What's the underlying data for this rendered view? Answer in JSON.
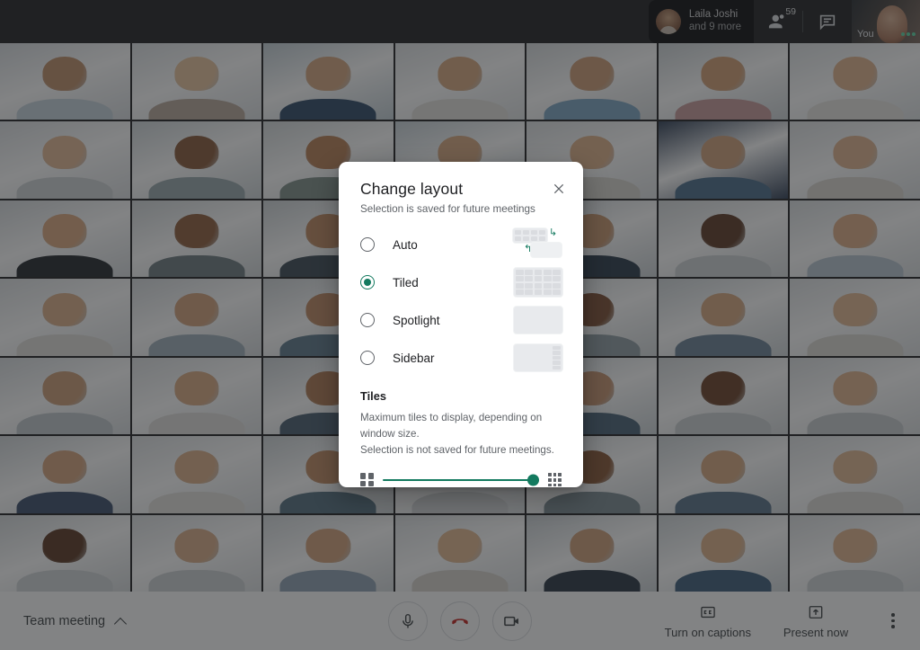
{
  "topbar": {
    "presence": {
      "name": "Laila Joshi",
      "more": "and 9 more"
    },
    "participants_icon": "people-icon",
    "participants_count": "59",
    "chat_icon": "chat-bubble-icon",
    "selfview_label": "You"
  },
  "grid": {
    "columns": 7,
    "rows": 7,
    "tiles": [
      {
        "skin": "#c08f6a",
        "hair": "#2a1a14",
        "top": "#c7d4dc",
        "bg": "#d9dde1"
      },
      {
        "skin": "#e8c49e",
        "hair": "#d8cdb6",
        "top": "#b9a89c",
        "bg": "#dde1e4"
      },
      {
        "skin": "#d6a77f",
        "hair": "#3a2a1e",
        "top": "#2f4a68",
        "bg": "#c3cfd6"
      },
      {
        "skin": "#d8a87f",
        "hair": "#6b4a32",
        "top": "#e4e2dc",
        "bg": "#dfe2e4"
      },
      {
        "skin": "#cf9e77",
        "hair": "#241812",
        "top": "#7ea6c4",
        "bg": "#d7dbdd"
      },
      {
        "skin": "#d4a075",
        "hair": "#2b1c14",
        "top": "#c99b9b",
        "bg": "#cdd3d6"
      },
      {
        "skin": "#e2b48e",
        "hair": "#8a6b45",
        "top": "#e8e6e2",
        "bg": "#dfe3e5"
      },
      {
        "skin": "#e3b894",
        "hair": "#8d6a44",
        "top": "#cfd3d6",
        "bg": "#dde0e3"
      },
      {
        "skin": "#8a5a3a",
        "hair": "#1b1210",
        "top": "#9aa9ad",
        "bg": "#cfd6d9"
      },
      {
        "skin": "#b97f56",
        "hair": "#221611",
        "top": "#7f8f8a",
        "bg": "#d4d9da"
      },
      {
        "skin": "#d8a87f",
        "hair": "#3c2a1d",
        "top": "#3f5a78",
        "bg": "#c8d2d8"
      },
      {
        "skin": "#e0b18a",
        "hair": "#6b4b2f",
        "top": "#d9d5cf",
        "bg": "#dde0e2"
      },
      {
        "skin": "#d2a27c",
        "hair": "#2a1c14",
        "top": "#4b6e8c",
        "bg": "#2f3e55"
      },
      {
        "skin": "#e2b58f",
        "hair": "#a07a4a",
        "top": "#dcd8d2",
        "bg": "#dee1e3"
      },
      {
        "skin": "#dca97f",
        "hair": "#5a3b23",
        "top": "#22272c",
        "bg": "#d7dbde"
      },
      {
        "skin": "#8f5e3c",
        "hair": "#1d1410",
        "top": "#6e7c80",
        "bg": "#d2d7d9"
      },
      {
        "skin": "#c08a60",
        "hair": "#231711",
        "top": "#3b4a55",
        "bg": "#cdd3d6"
      },
      {
        "skin": "#e0b68f",
        "hair": "#8b6840",
        "top": "#cfd2d4",
        "bg": "#dde0e2"
      },
      {
        "skin": "#c9966e",
        "hair": "#241812",
        "top": "#2b3a4a",
        "bg": "#cbd1d5"
      },
      {
        "skin": "#5d3a26",
        "hair": "#140e0b",
        "top": "#cfd3d5",
        "bg": "#d6dadc"
      },
      {
        "skin": "#dfae86",
        "hair": "#6a4a2d",
        "top": "#b8c6d2",
        "bg": "#dce0e2"
      },
      {
        "skin": "#dcb08a",
        "hair": "#2b1d14",
        "top": "#e1dfdb",
        "bg": "#dfe2e4"
      },
      {
        "skin": "#d4a37c",
        "hair": "#382619",
        "top": "#9fb0bb",
        "bg": "#d6dadd"
      },
      {
        "skin": "#c08a62",
        "hair": "#201611",
        "top": "#5f7a8c",
        "bg": "#cfd4d7"
      },
      {
        "skin": "#e1b58e",
        "hair": "#7b5a38",
        "top": "#d2d6d8",
        "bg": "#dde1e3"
      },
      {
        "skin": "#7d4f32",
        "hair": "#181110",
        "top": "#8f9ea4",
        "bg": "#d3d8da"
      },
      {
        "skin": "#d9a87f",
        "hair": "#3a2718",
        "top": "#6b8296",
        "bg": "#d0d6d9"
      },
      {
        "skin": "#e3b993",
        "hair": "#a8834f",
        "top": "#dedad4",
        "bg": "#e0e3e5"
      },
      {
        "skin": "#cd9d76",
        "hair": "#4a3120",
        "top": "#c2c9ce",
        "bg": "#d9dde0"
      },
      {
        "skin": "#dbaa82",
        "hair": "#2e2015",
        "top": "#e2e0dc",
        "bg": "#dee1e3"
      },
      {
        "skin": "#b07a52",
        "hair": "#1e1511",
        "top": "#4a5f70",
        "bg": "#ccd2d6"
      },
      {
        "skin": "#e0b289",
        "hair": "#6e5032",
        "top": "#d6d9db",
        "bg": "#dce0e2"
      },
      {
        "skin": "#c99570",
        "hair": "#27190f",
        "top": "#4a6378",
        "bg": "#cdd4d8"
      },
      {
        "skin": "#6b4128",
        "hair": "#150f0c",
        "top": "#cdd1d3",
        "bg": "#d5d9db"
      },
      {
        "skin": "#e1b48d",
        "hair": "#8f6c42",
        "top": "#c8ccd0",
        "bg": "#dde0e2"
      },
      {
        "skin": "#d7a57e",
        "hair": "#3a2718",
        "top": "#3c4f6b",
        "bg": "#d2d7da"
      },
      {
        "skin": "#ddb089",
        "hair": "#6d4c2e",
        "top": "#e3e1dd",
        "bg": "#dfe2e4"
      },
      {
        "skin": "#c28c63",
        "hair": "#221711",
        "top": "#56707f",
        "bg": "#ced4d7"
      },
      {
        "skin": "#e0b48e",
        "hair": "#7f5e3a",
        "top": "#d5d8da",
        "bg": "#dce0e2"
      },
      {
        "skin": "#8a5836",
        "hair": "#171110",
        "top": "#7b8c93",
        "bg": "#d1d6d9"
      },
      {
        "skin": "#d9a97f",
        "hair": "#2d1e15",
        "top": "#5a7388",
        "bg": "#cfd5d8"
      },
      {
        "skin": "#e2b892",
        "hair": "#9c784a",
        "top": "#dedad5",
        "bg": "#e0e3e5"
      },
      {
        "skin": "#5b3823",
        "hair": "#130d0b",
        "top": "#d2d6d8",
        "bg": "#d6dadc"
      },
      {
        "skin": "#dbae88",
        "hair": "#6a4a2c",
        "top": "#cdd1d4",
        "bg": "#dde0e2"
      },
      {
        "skin": "#d4a27b",
        "hair": "#332217",
        "top": "#8fa3b3",
        "bg": "#d4d9dc"
      },
      {
        "skin": "#e3b890",
        "hair": "#b0b0ae",
        "top": "#d8d4ce",
        "bg": "#dfe2e4"
      },
      {
        "skin": "#d0a07a",
        "hair": "#241811",
        "top": "#2a3542",
        "bg": "#cbd1d5"
      },
      {
        "skin": "#dfb289",
        "hair": "#5f4229",
        "top": "#3f5f7c",
        "bg": "#d1d7da"
      },
      {
        "skin": "#e1b48d",
        "hair": "#7a5834",
        "top": "#cfd3d6",
        "bg": "#dde0e2"
      }
    ]
  },
  "bottombar": {
    "meeting_name": "Team meeting",
    "expand_icon": "chevron-up-icon",
    "mic_icon": "microphone-icon",
    "hangup_icon": "end-call-icon",
    "camera_icon": "video-camera-icon",
    "captions_label": "Turn on captions",
    "captions_icon": "closed-caption-icon",
    "present_label": "Present now",
    "present_icon": "present-screen-icon",
    "more_icon": "more-vertical-icon"
  },
  "dialog": {
    "title": "Change layout",
    "subtitle": "Selection is saved for future meetings",
    "close_icon": "close-icon",
    "accent_color": "#137a5f",
    "options": [
      {
        "label": "Auto",
        "selected": false,
        "preview": "auto-layout-preview"
      },
      {
        "label": "Tiled",
        "selected": true,
        "preview": "tiled-layout-preview"
      },
      {
        "label": "Spotlight",
        "selected": false,
        "preview": "spotlight-layout-preview"
      },
      {
        "label": "Sidebar",
        "selected": false,
        "preview": "sidebar-layout-preview"
      }
    ],
    "tiles_section": {
      "heading": "Tiles",
      "description_line1": "Maximum tiles to display, depending on window size.",
      "description_line2": "Selection is not saved for future meetings.",
      "min_icon": "small-grid-icon",
      "max_icon": "large-grid-icon",
      "value": "49",
      "min": "1",
      "max": "49"
    }
  }
}
